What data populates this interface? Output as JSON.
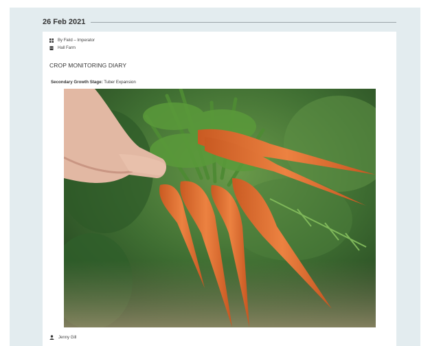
{
  "entry": {
    "date": "26 Feb 2021",
    "field": "By Field – Imperator",
    "farm": "Hall Farm",
    "title": "CROP MONITORING DIARY",
    "stage_label": "Secondary Growth Stage:",
    "stage_value": "Tuber Expansion",
    "author": "Jenny Gill"
  },
  "icons": {
    "field": "field-grid-icon",
    "farm": "building-icon",
    "author": "user-icon"
  },
  "photo": {
    "subject": "hand-holding-carrot-bunch"
  },
  "colors": {
    "page_bg": "#e3ecef",
    "card_bg": "#ffffff",
    "carrot": "#e5732f",
    "foliage": "#3f7a2f"
  }
}
